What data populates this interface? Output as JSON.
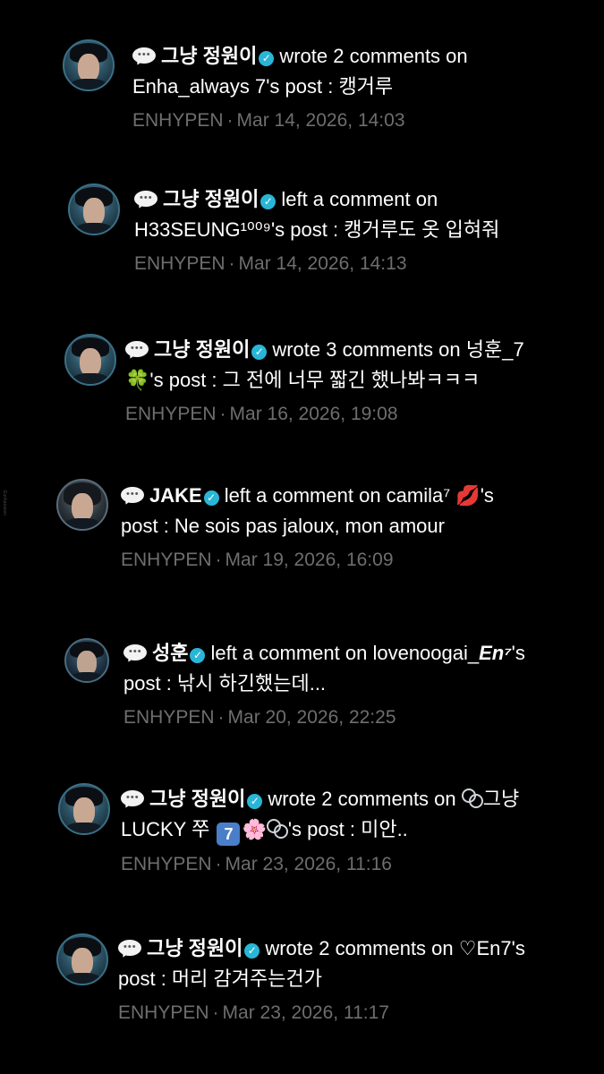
{
  "side_watermark": "Eunhaeaxen",
  "notifications": [
    {
      "user": "그냥 정원이",
      "verified": true,
      "line1_action": "wrote 2 comments on",
      "line2": "Enha_always 7's post : 캥거루",
      "group": "ENHYPEN",
      "separator": "·",
      "time": "Mar 14, 2026, 14:03"
    },
    {
      "user": "그냥 정원이",
      "verified": true,
      "line1_action": "left a comment on",
      "line2": "H33SEUNG¹⁰⁰⁹'s post : 캥거루도 옷 입혀줘",
      "group": "ENHYPEN",
      "separator": "·",
      "time": "Mar 14, 2026, 14:13"
    },
    {
      "user": "그냥 정원이",
      "verified": true,
      "line1_action": "wrote 3 comments on 넝훈_7",
      "line2_emoji": "🍀",
      "line2": "'s post : 그 전에 너무 짧긴 했나봐ㅋㅋㅋ",
      "group": "ENHYPEN",
      "separator": "·",
      "time": "Mar 16, 2026, 19:08"
    },
    {
      "user": "JAKE",
      "verified": true,
      "line1_action": "left a comment on camila⁷",
      "line1_emoji": "💋",
      "line1_tail": "'s",
      "line2": "post : Ne sois pas jaloux, mon amour",
      "group": "ENHYPEN",
      "separator": "·",
      "time": "Mar 19, 2026, 16:09"
    },
    {
      "user": "성훈",
      "verified": true,
      "line1_action": "left a comment on lovenoogai_",
      "line1_bold": "En⁷",
      "line1_tail": "'s",
      "line2": "post : 낚시 하긴했는데...",
      "group": "ENHYPEN",
      "separator": "·",
      "time": "Mar 20, 2026, 22:25"
    },
    {
      "user": "그냥 정원이",
      "verified": true,
      "line1_action": "wrote 2 comments on",
      "line1_tail": "그냥",
      "line2_pre": "LUCKY 쭈",
      "line2_box": "7",
      "line2_emoji": "🌸",
      "line2": "'s post : 미안..",
      "group": "ENHYPEN",
      "separator": "·",
      "time": "Mar 23, 2026, 11:16"
    },
    {
      "user": "그냥 정원이",
      "verified": true,
      "line1_action": "wrote 2 comments on ♡En7's",
      "line2": "post : 머리 감겨주는건가",
      "group": "ENHYPEN",
      "separator": "·",
      "time": "Mar 23, 2026, 11:17"
    }
  ]
}
